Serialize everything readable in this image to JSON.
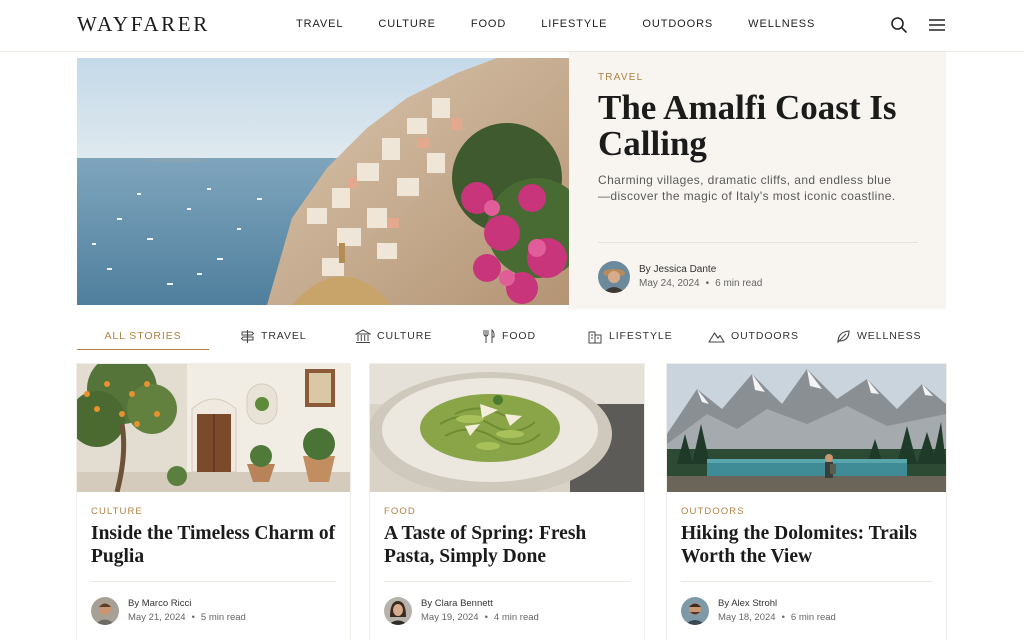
{
  "brand": {
    "name": "WAYFARER",
    "accent": "#b08244"
  },
  "nav": {
    "items": [
      "TRAVEL",
      "CULTURE",
      "FOOD",
      "LIFESTYLE",
      "OUTDOORS",
      "WELLNESS"
    ]
  },
  "header": {
    "icons": [
      "search-icon",
      "menu-icon"
    ]
  },
  "hero": {
    "kicker": "TRAVEL",
    "title": "The Amalfi Coast Is Calling",
    "dek": "Charming villages, dramatic cliffs, and endless blue—discover the magic of Italy's most iconic coastline.",
    "author_line": "By Jessica Dante",
    "date": "May 24, 2024",
    "read_time": "6 min read"
  },
  "filters": {
    "active": "ALL STORIES",
    "items": [
      {
        "label": "ALL STORIES",
        "icon": ""
      },
      {
        "label": "TRAVEL",
        "icon": "signpost-icon"
      },
      {
        "label": "CULTURE",
        "icon": "museum-icon"
      },
      {
        "label": "FOOD",
        "icon": "utensils-icon"
      },
      {
        "label": "LIFESTYLE",
        "icon": "city-icon"
      },
      {
        "label": "OUTDOORS",
        "icon": "mountain-icon"
      },
      {
        "label": "WELLNESS",
        "icon": "leaf-icon"
      }
    ]
  },
  "cards": [
    {
      "kicker": "CULTURE",
      "title": "Inside the Timeless Charm of Puglia",
      "author_line": "By Marco Ricci",
      "date": "May 21, 2024",
      "read_time": "5 min read"
    },
    {
      "kicker": "FOOD",
      "title": "A Taste of Spring: Fresh Pasta, Simply Done",
      "author_line": "By Clara Bennett",
      "date": "May 19, 2024",
      "read_time": "4 min read"
    },
    {
      "kicker": "OUTDOORS",
      "title": "Hiking the Dolomites: Trails Worth the View",
      "author_line": "By Alex Strohl",
      "date": "May 18, 2024",
      "read_time": "6 min read"
    }
  ],
  "separator": "•"
}
